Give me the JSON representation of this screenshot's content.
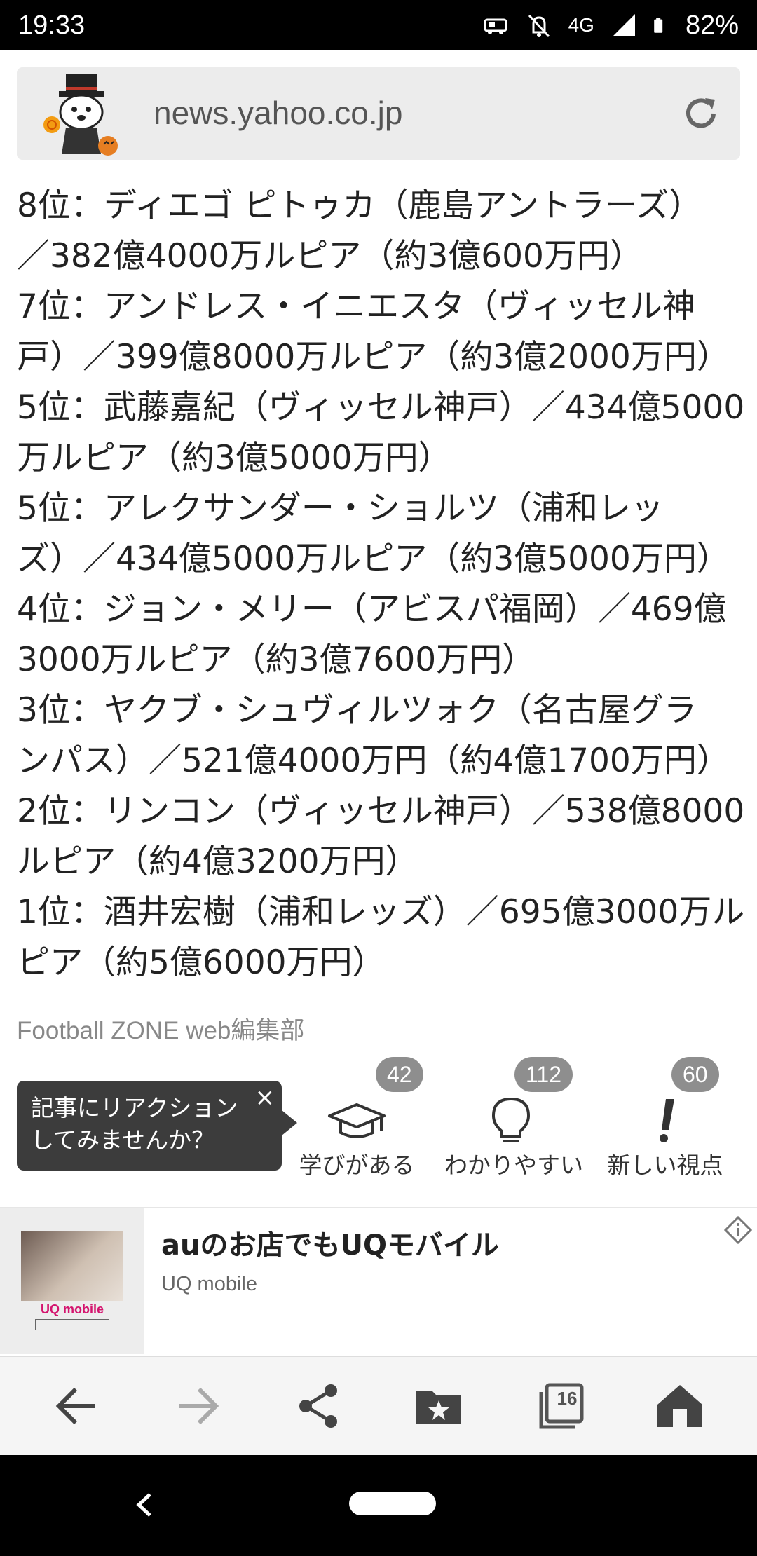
{
  "status_bar": {
    "time": "19:33",
    "network": "4G",
    "battery": "82%"
  },
  "browser": {
    "url": "news.yahoo.co.jp"
  },
  "article": {
    "lines": [
      "8位：ディエゴ ピトゥカ（鹿島アントラーズ）",
      "／382億4000万ルピア（約3億600万円）",
      "7位：アンドレス・イニエスタ（ヴィッセル神",
      "戸）／399億8000万ルピア（約3億2000万円）",
      "5位：武藤嘉紀（ヴィッセル神戸）／434億5000",
      "万ルピア（約3億5000万円）",
      "5位：アレクサンダー・ショルツ（浦和レッ",
      "ズ）／434億5000万ルピア（約3億5000万円）",
      "4位：ジョン・メリー（アビスパ福岡）／469億",
      "3000万ルピア（約3億7600万円）",
      "3位：ヤクブ・シュヴィルツォク（名古屋グラ",
      "ンパス）／521億4000万円（約4億1700万円）",
      "2位：リンコン（ヴィッセル神戸）／538億8000",
      "ルピア（約4億3200万円）",
      "1位：酒井宏樹（浦和レッズ）／695億3000万ル",
      "ピア（約5億6000万円）"
    ],
    "source": "Football ZONE web編集部"
  },
  "reactions": {
    "tooltip": [
      "記事にリアクション",
      "してみませんか？"
    ],
    "tooltip_close": "×",
    "items": [
      {
        "label": "学びがある",
        "count": "42"
      },
      {
        "label": "わかりやすい",
        "count": "112"
      },
      {
        "label": "新しい視点",
        "count": "60"
      }
    ]
  },
  "ad": {
    "title": "auのお店でもUQモバイル",
    "advertiser": "UQ mobile",
    "thumb_logo": "UQ mobile"
  },
  "toolbar": {
    "tab_count": "16"
  },
  "icons": {
    "status": [
      "car-mode-icon",
      "alarm-off-icon",
      "signal-icon",
      "battery-icon"
    ],
    "toolbar": [
      "back-arrow-icon",
      "forward-arrow-icon",
      "share-icon",
      "bookmark-folder-icon",
      "tabs-icon",
      "home-icon"
    ],
    "reactions": [
      "graduation-cap-icon",
      "lightbulb-icon",
      "exclamation-icon"
    ]
  },
  "colors": {
    "status_bar_bg": "#000000",
    "url_bar_bg": "#ececec",
    "tooltip_bg": "#3c3c3c",
    "count_badge": "#8e8e8e",
    "toolbar_bg": "#f5f5f5"
  }
}
